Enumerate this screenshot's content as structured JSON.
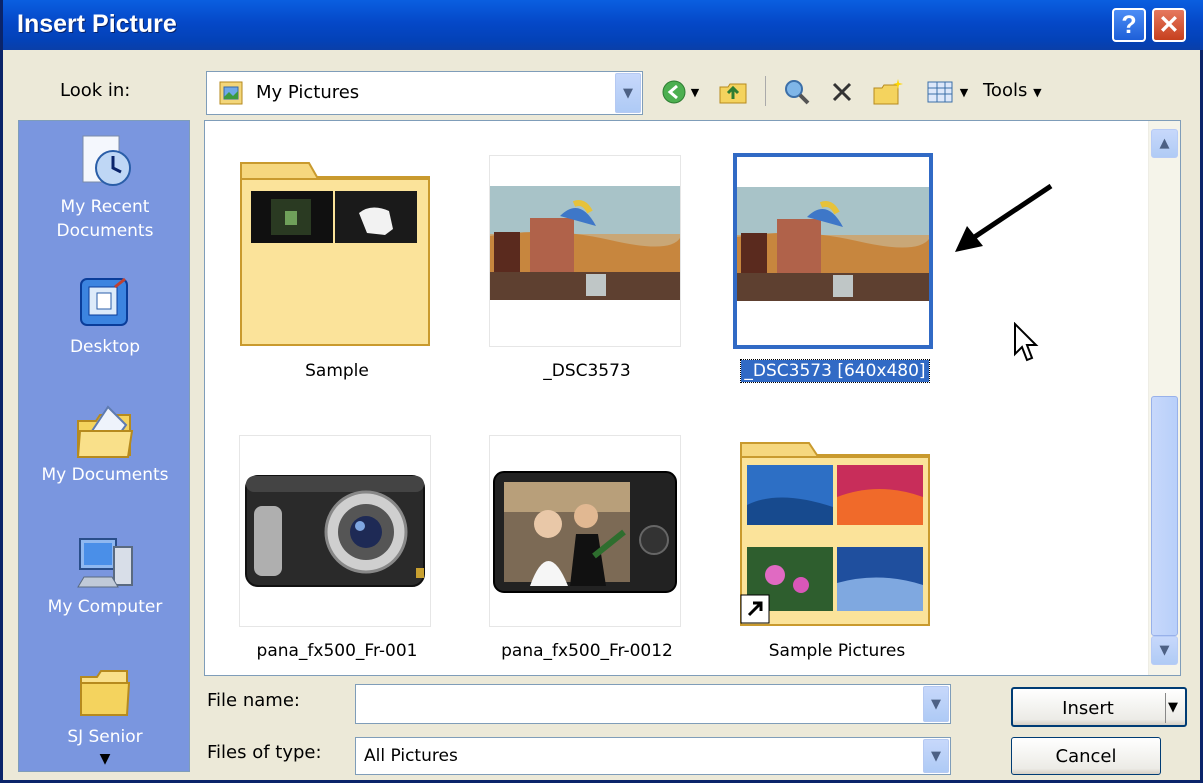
{
  "window": {
    "title": "Insert Picture",
    "help_label": "?",
    "close_label": "✕"
  },
  "toolbar": {
    "look_in_label": "Look in:",
    "look_in_value": "My Pictures",
    "tools_label": "Tools"
  },
  "places": [
    {
      "label_line1": "My Recent",
      "label_line2": "Documents",
      "icon": "recent-documents-icon"
    },
    {
      "label_line1": "Desktop",
      "label_line2": "",
      "icon": "desktop-icon"
    },
    {
      "label_line1": "My Documents",
      "label_line2": "",
      "icon": "my-documents-icon"
    },
    {
      "label_line1": "My Computer",
      "label_line2": "",
      "icon": "my-computer-icon"
    },
    {
      "label_line1": "SJ Senior",
      "label_line2": "",
      "icon": "folder-icon"
    }
  ],
  "files": [
    {
      "name": "Sample",
      "type": "folder",
      "selected": false
    },
    {
      "name": "_DSC3573",
      "type": "image",
      "selected": false
    },
    {
      "name": "_DSC3573 [640x480]",
      "type": "image",
      "selected": true
    },
    {
      "name": "pana_fx500_Fr-001",
      "type": "image",
      "selected": false
    },
    {
      "name": "pana_fx500_Fr-0012",
      "type": "image",
      "selected": false
    },
    {
      "name": "Sample Pictures",
      "type": "folder-shortcut",
      "selected": false
    }
  ],
  "form": {
    "file_name_label": "File name:",
    "file_name_value": "",
    "file_type_label": "Files of type:",
    "file_type_value": "All Pictures",
    "insert_label": "Insert",
    "cancel_label": "Cancel"
  },
  "colors": {
    "title_bar": "#0548C8",
    "selection": "#316AC5",
    "places_bar": "#7A96DF"
  }
}
